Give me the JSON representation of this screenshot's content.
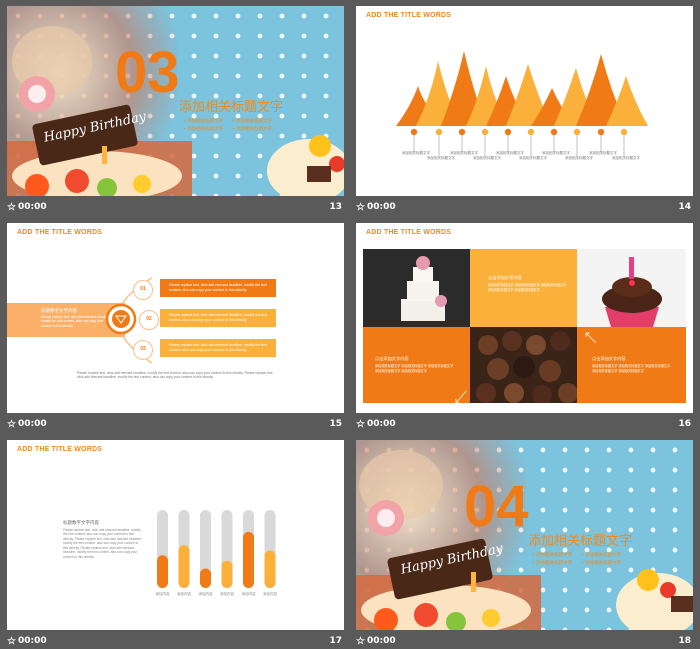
{
  "slides": [
    {
      "number": "13",
      "time": "00:00",
      "big_number": "03",
      "title": "添加相关标题文字",
      "bullets": [
        "添加相关标题文字",
        "添加相关标题文字",
        "添加相关标题文字",
        "添加相关标题文字"
      ],
      "cake_text": "Happy Birthday"
    },
    {
      "number": "14",
      "time": "00:00",
      "header": "ADD THE TITLE WORDS",
      "labels": [
        "添加相关标题文字",
        "添加相关标题文字",
        "添加相关标题文字",
        "添加相关标题文字",
        "添加相关标题文字",
        "添加相关标题文字",
        "添加相关标题文字",
        "添加相关标题文字",
        "添加相关标题文字",
        "添加相关标题文字"
      ]
    },
    {
      "number": "15",
      "time": "00:00",
      "header": "ADD THE TITLE WORDS",
      "left_title": "标题数字文字内容",
      "left_text": "Please replace text, click add relevant headline, modify the text content, also can copy your content to this directly.",
      "steps": [
        {
          "id": "01",
          "text": "Please replace text, click add relevant headline, modify the text content, also can copy your content to this directly."
        },
        {
          "id": "02",
          "text": "Please replace text, click add relevant headline, modify the text content, also can copy your content to this directly."
        },
        {
          "id": "03",
          "text": "Please replace text, click add relevant headline, modify the text content, also can copy your content to this directly."
        }
      ],
      "footer_text": "Please replace text, click add relevant headline, modify the text content, also can copy your content to this directly. Please replace text, click add relevant headline, modify the text content, also can copy your content to this directly."
    },
    {
      "number": "16",
      "time": "00:00",
      "header": "ADD THE TITLE WORDS",
      "box_titles": [
        "点击添加文字内容",
        "点击添加文字内容",
        "点击添加文字内容"
      ],
      "box_text": "添加相关标题文字 添加相关标题文字 添加相关标题文字 添加相关标题文字 添加相关标题文字"
    },
    {
      "number": "17",
      "time": "00:00",
      "header": "ADD THE TITLE WORDS",
      "text_title": "标题数字文字内容",
      "text_body": "Please replace text, click add relevant headline, modify the text content, also can copy your content to this directly. Please replace text, click add relevant headline, modify the text content, also can copy your content to this directly. Please replace text, click add relevant headline, modify the text content, also can copy your content to this directly.",
      "bar_labels": [
        "添加内容",
        "添加内容",
        "添加内容",
        "添加内容",
        "添加内容"
      ]
    },
    {
      "number": "18",
      "time": "00:00",
      "big_number": "04",
      "title": "添加相关标题文字",
      "bullets": [
        "添加相关标题文字",
        "添加相关标题文字",
        "添加相关标题文字",
        "添加相关标题文字"
      ],
      "cake_text": "Happy Birthday"
    }
  ],
  "chart_data": {
    "type": "bar",
    "categories": [
      "添加内容",
      "添加内容",
      "添加内容",
      "添加内容",
      "添加内容",
      "添加内容"
    ],
    "values": [
      0.42,
      0.55,
      0.25,
      0.35,
      0.72,
      0.48
    ],
    "ylim": [
      0,
      1
    ]
  },
  "colors": {
    "accent": "#f07b16",
    "accent_light": "#fbb03b",
    "sky": "#7cc3de",
    "bar_track": "#d9d9d9"
  }
}
